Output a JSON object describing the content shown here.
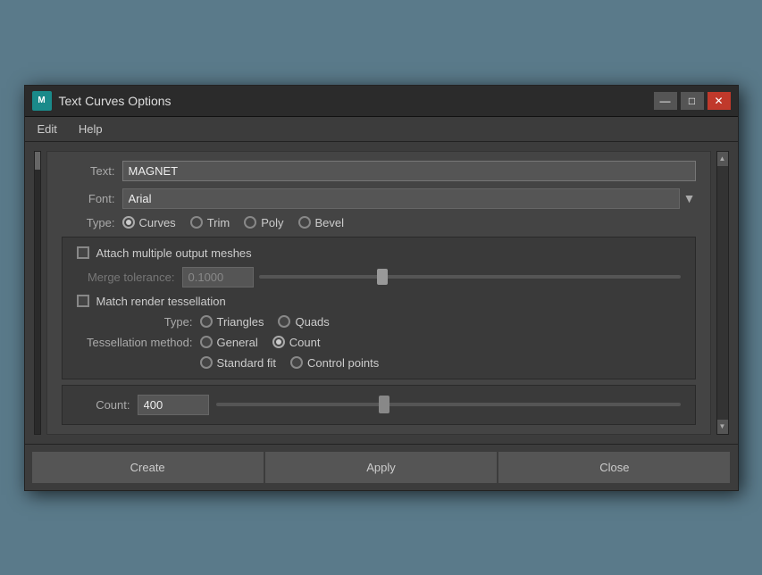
{
  "title": "Text Curves Options",
  "app_icon": "M",
  "menu": {
    "edit": "Edit",
    "help": "Help"
  },
  "form": {
    "text_label": "Text:",
    "text_value": "MAGNET",
    "font_label": "Font:",
    "font_value": "Arial",
    "type_label": "Type:",
    "type_options": [
      "Curves",
      "Trim",
      "Poly",
      "Bevel"
    ],
    "type_selected": "Curves"
  },
  "inner": {
    "attach_label": "Attach multiple output meshes",
    "merge_label": "Merge tolerance:",
    "merge_value": "0.1000",
    "match_label": "Match render tessellation",
    "type_label": "Type:",
    "triangles": "Triangles",
    "quads": "Quads",
    "tessellation_label": "Tessellation method:",
    "general": "General",
    "count": "Count",
    "standard_fit": "Standard fit",
    "control_points": "Control points"
  },
  "count_section": {
    "label": "Count:",
    "value": "400"
  },
  "buttons": {
    "create": "Create",
    "apply": "Apply",
    "close": "Close"
  },
  "slider_merge": {
    "position_pct": 30
  },
  "slider_count": {
    "position_pct": 35
  }
}
